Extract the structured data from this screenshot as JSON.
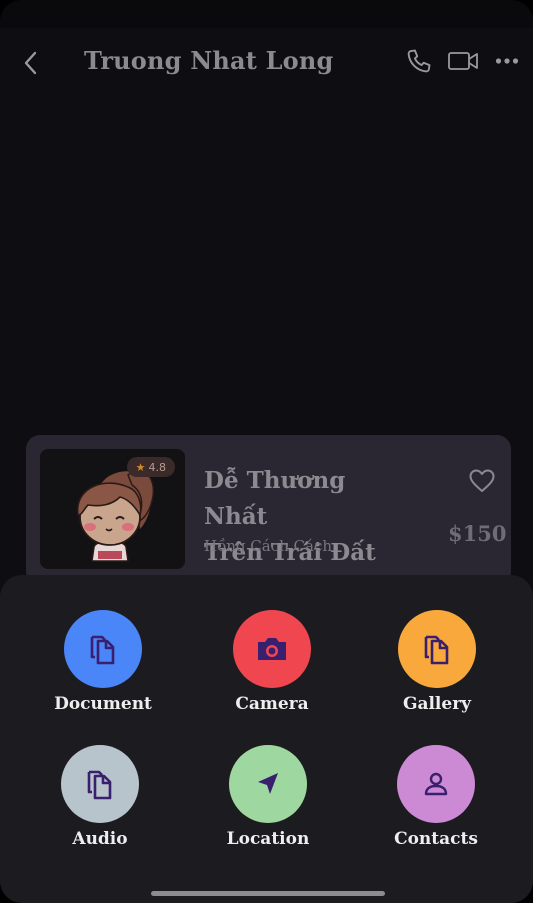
{
  "header": {
    "title": "Truong Nhat Long",
    "icons": [
      "back-arrow-icon",
      "phone-icon",
      "video-camera-icon",
      "more-dots-icon"
    ]
  },
  "product": {
    "rating": "4.8",
    "title_line1": "Dễ Thương Nhất",
    "title_line2": "Trên Trái Đất",
    "shop": "Hồng Cách Cách",
    "price": "$150",
    "icons": [
      "star-icon",
      "heart-icon"
    ]
  },
  "attachments": [
    {
      "label": "Document",
      "color": "#4a86f7",
      "icon": "document-copy-icon"
    },
    {
      "label": "Camera",
      "color": "#f0464f",
      "icon": "camera-icon"
    },
    {
      "label": "Gallery",
      "color": "#f9a93b",
      "icon": "document-copy-icon"
    },
    {
      "label": "Audio",
      "color": "#b8c4cc",
      "icon": "document-copy-icon"
    },
    {
      "label": "Location",
      "color": "#9ed8a0",
      "icon": "location-arrow-icon"
    },
    {
      "label": "Contacts",
      "color": "#cc8ad4",
      "icon": "person-icon"
    }
  ],
  "colors": {
    "background": "#0e0d12",
    "card": "#2b2732",
    "sheet": "#1c1b20",
    "icon_glyph": "#3a1f6e"
  }
}
